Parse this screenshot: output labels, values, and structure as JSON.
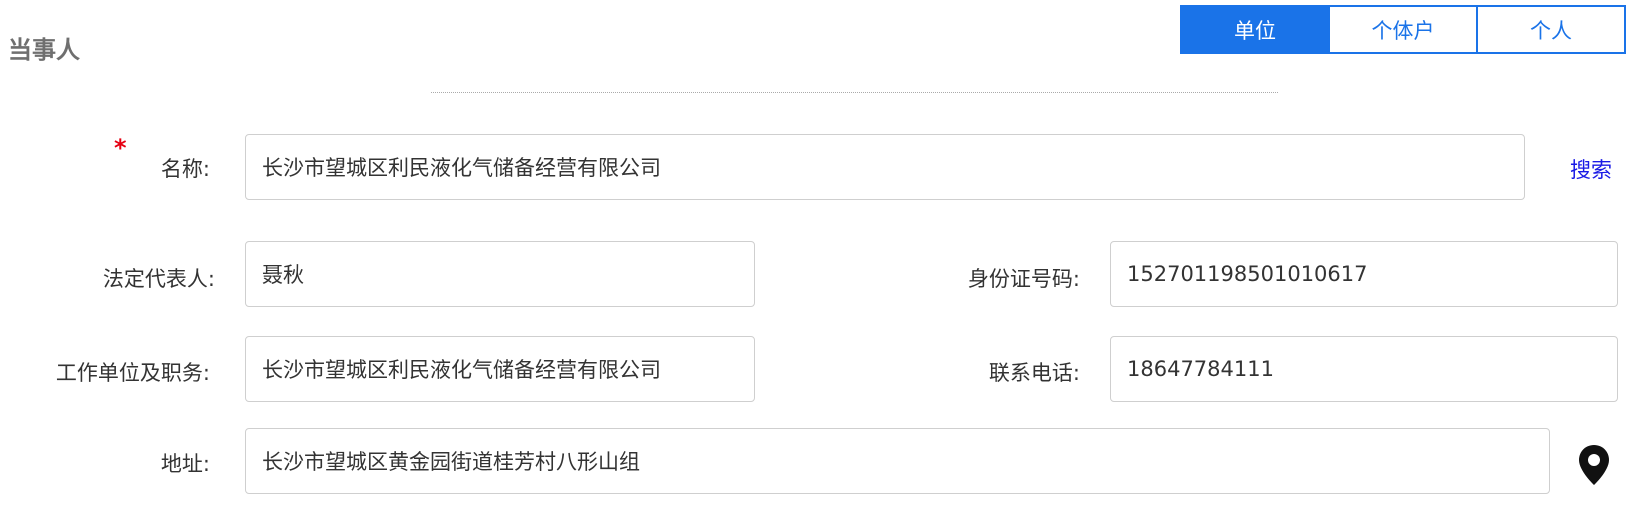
{
  "section": {
    "title": "当事人"
  },
  "party_type": {
    "options": [
      "单位",
      "个体户",
      "个人"
    ],
    "selected": "单位"
  },
  "form": {
    "name": {
      "label": "名称:",
      "required_mark": "*",
      "value": "长沙市望城区利民液化气储备经营有限公司",
      "search_label": "搜索"
    },
    "legal_rep": {
      "label": "法定代表人:",
      "value": "聂秋"
    },
    "id_number": {
      "label": "身份证号码:",
      "value": "152701198501010617"
    },
    "work_unit": {
      "label": "工作单位及职务:",
      "value": "长沙市望城区利民液化气储备经营有限公司"
    },
    "phone": {
      "label": "联系电话:",
      "value": "18647784111"
    },
    "address": {
      "label": "地址:",
      "value": "长沙市望城区黄金园街道桂芳村八形山组"
    }
  },
  "icons": {
    "location": "map-pin-icon"
  },
  "colors": {
    "accent": "#1a73e8",
    "required": "#e60012",
    "link": "#1a1ae6"
  }
}
